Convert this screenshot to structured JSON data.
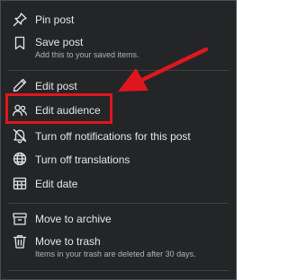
{
  "menu": {
    "pin_post": "Pin post",
    "save_post": "Save post",
    "save_post_sub": "Add this to your saved items.",
    "edit_post": "Edit post",
    "edit_audience": "Edit audience",
    "turn_off_notifications": "Turn off notifications for this post",
    "turn_off_translations": "Turn off translations",
    "edit_date": "Edit date",
    "move_to_archive": "Move to archive",
    "move_to_trash": "Move to trash",
    "move_to_trash_sub": "Items in your trash are deleted after 30 days."
  },
  "icons": {
    "pin": "pin-icon",
    "bookmark": "bookmark-icon",
    "pencil": "pencil-icon",
    "audience": "audience-icon",
    "bell_off": "bell-off-icon",
    "globe": "globe-icon",
    "calendar": "calendar-icon",
    "archive": "archive-icon",
    "trash": "trash-icon"
  },
  "colors": {
    "menu_bg": "#242526",
    "text": "#e4e6eb",
    "subtext": "#b0b3b8",
    "highlight": "#e0161e"
  }
}
